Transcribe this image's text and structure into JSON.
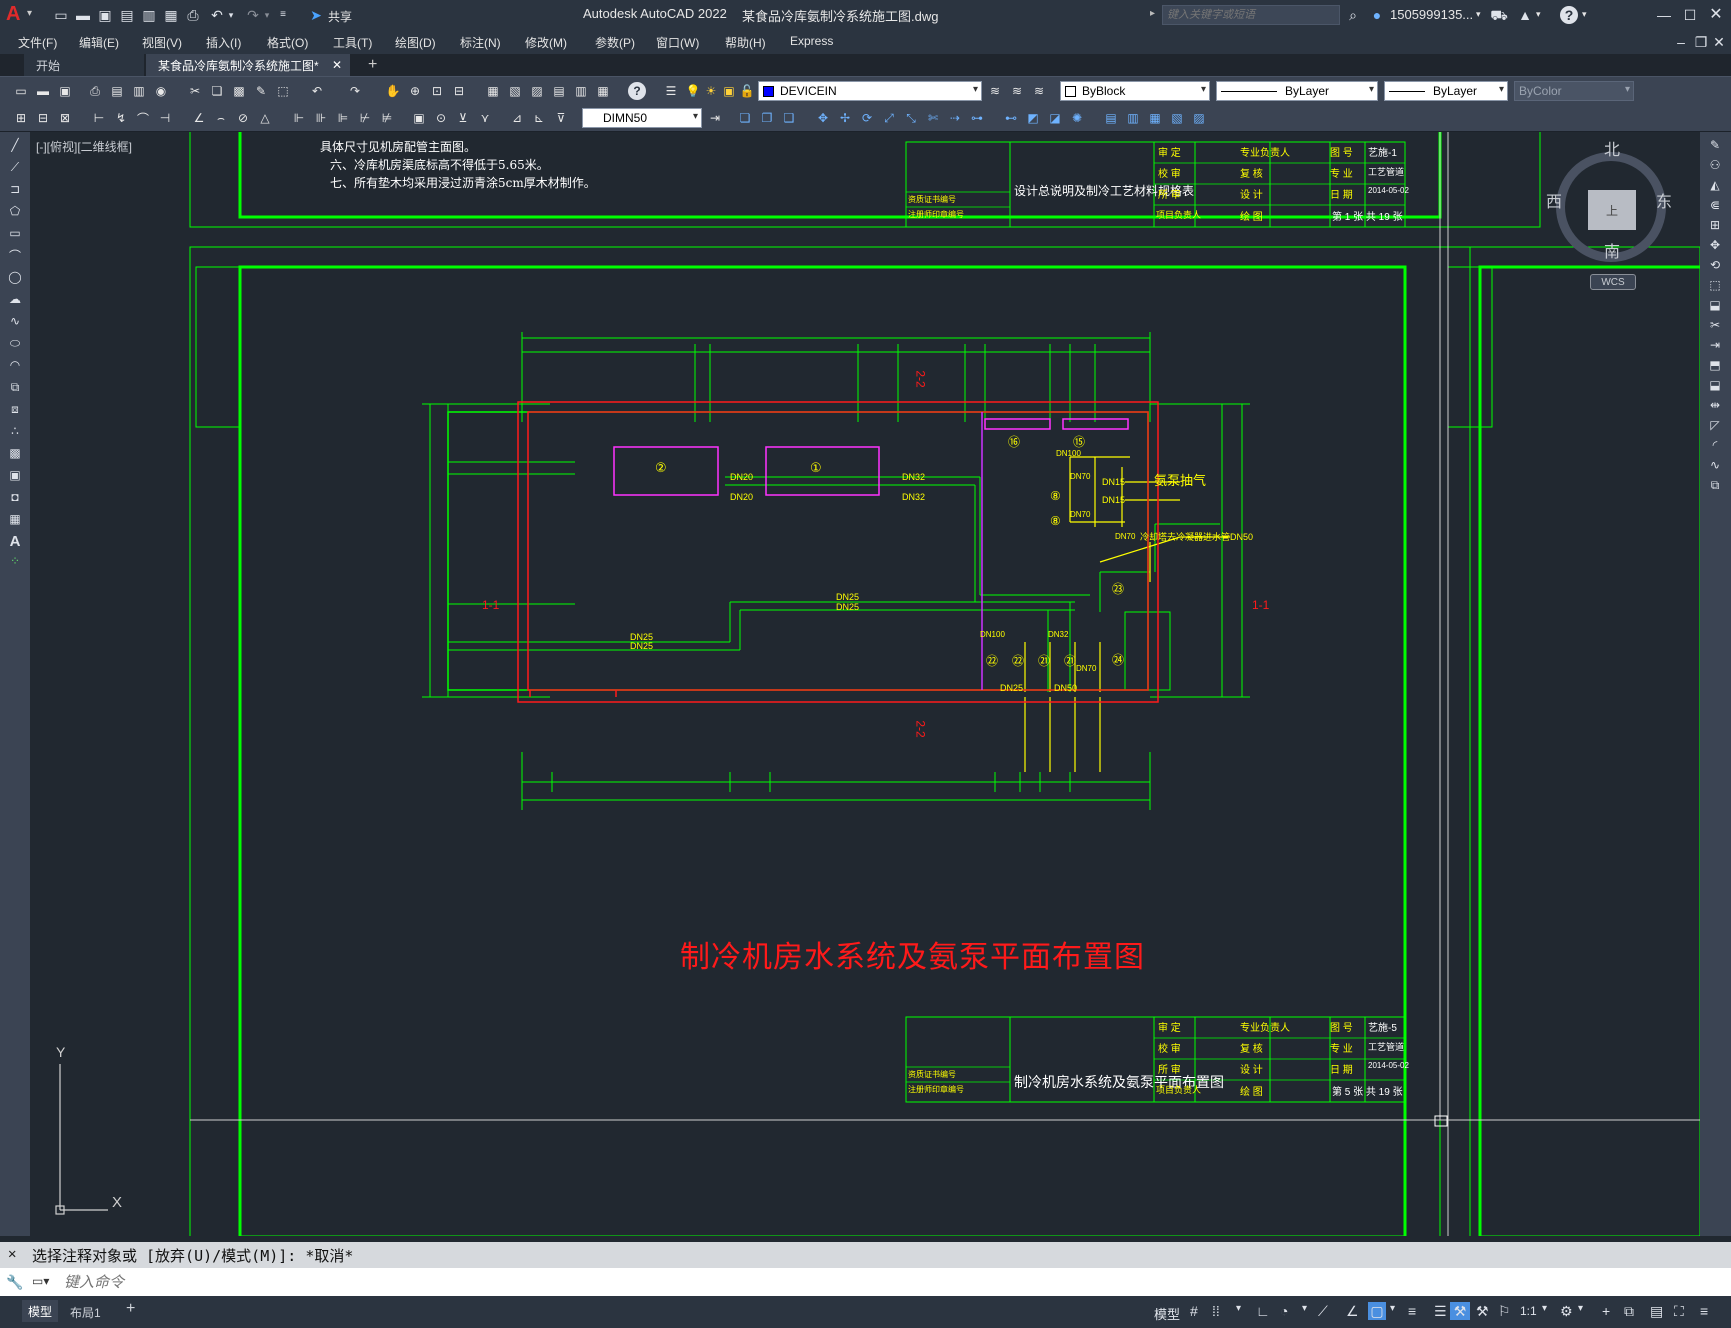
{
  "titlebar": {
    "app_title": "Autodesk AutoCAD 2022",
    "file_title": "某食品冷库氨制冷系统施工图.dwg",
    "share_label": "共享",
    "search_placeholder": "键入关键字或短语",
    "user_label": "1505999135...",
    "help_label": "?"
  },
  "menubar": {
    "items": [
      "文件(F)",
      "编辑(E)",
      "视图(V)",
      "插入(I)",
      "格式(O)",
      "工具(T)",
      "绘图(D)",
      "标注(N)",
      "修改(M)",
      "参数(P)",
      "窗口(W)",
      "帮助(H)",
      "Express"
    ]
  },
  "tabs": {
    "start": "开始",
    "active": "某食品冷库氨制冷系统施工图*",
    "add": "+"
  },
  "toolbar1": {
    "layer": "DEVICEIN",
    "color": "ByBlock",
    "linetype": "ByLayer",
    "lineweight": "ByLayer",
    "plotstyle": "ByColor"
  },
  "toolbar2": {
    "dimstyle": "DIMN50"
  },
  "viewport": {
    "label": "[-][俯视][二维线框]"
  },
  "viewcube": {
    "north": "北",
    "south": "南",
    "east": "东",
    "west": "西",
    "face": "上",
    "wcs": "WCS"
  },
  "ucs": {
    "x": "X",
    "y": "Y"
  },
  "drawing": {
    "notes": [
      "具体尺寸见机房配管主面图。",
      "六、冷库机房渠底标高不得低于5.65米。",
      "七、所有垫木均采用浸过沥青涂5cm厚木材制作。"
    ],
    "main_title": "制冷机房水系统及氨泵平面布置图",
    "title_block_top_name": "设计总说明及制冷工艺材料规格表",
    "title_block_bottom_name": "制冷机房水系统及氨泵平面布置图",
    "tb_top_labels": [
      "审 定",
      "专业负责人",
      "图 号",
      "艺施-1",
      "校 审",
      "复 核",
      "专 业",
      "工艺管道",
      "所 审",
      "设 计",
      "日 期",
      "2014-05-02",
      "项目负责人",
      "绘 图",
      "第 1 张 共 19 张"
    ],
    "tb_bottom_labels": [
      "审 定",
      "专业负责人",
      "图 号",
      "艺施-5",
      "校 审",
      "复 核",
      "专 业",
      "工艺管道",
      "所 审",
      "设 计",
      "日 期",
      "2014-05-02",
      "项目负责人",
      "绘 图",
      "第 5 张 共 19 张"
    ],
    "tb_left_labels": [
      "资质证书编号",
      "注册师印章编号"
    ],
    "pipe_labels": {
      "dn20_a": "DN20",
      "dn20_b": "DN20",
      "dn32_a": "DN32",
      "dn32_b": "DN32",
      "dn25_a": "DN25",
      "dn25_b": "DN25",
      "dn25_c": "DN25",
      "dn25_d": "DN25",
      "dn25_e": "DN25",
      "dn100_a": "DN100",
      "dn100_b": "DN100",
      "dn15_a": "DN15",
      "dn15_b": "DN15",
      "dn70_a": "DN70",
      "dn70_b": "DN70",
      "dn70_c": "DN70",
      "dn70_d": "DN70",
      "dn50_a": "DN50",
      "dn32_c": "DN32",
      "ammonia_pump": "氨泵抽气",
      "cooling_note": "冷却塔去冷凝器进水管DN50"
    },
    "equipment": [
      "①",
      "②",
      "⑯",
      "⑮",
      "⑧",
      "⑧",
      "㉓",
      "㉒",
      "㉒",
      "㉑",
      "㉑",
      "㉔"
    ],
    "section_marks": [
      "1-1",
      "1-1",
      "2-2",
      "2-2"
    ]
  },
  "command": {
    "history": "选择注释对象或 [放弃(U)/模式(M)]: *取消*",
    "placeholder": "键入命令"
  },
  "statusbar": {
    "model_tab": "模型",
    "layout_tab": "布局1",
    "add": "+",
    "model_btn": "模型",
    "scale": "1:1"
  }
}
